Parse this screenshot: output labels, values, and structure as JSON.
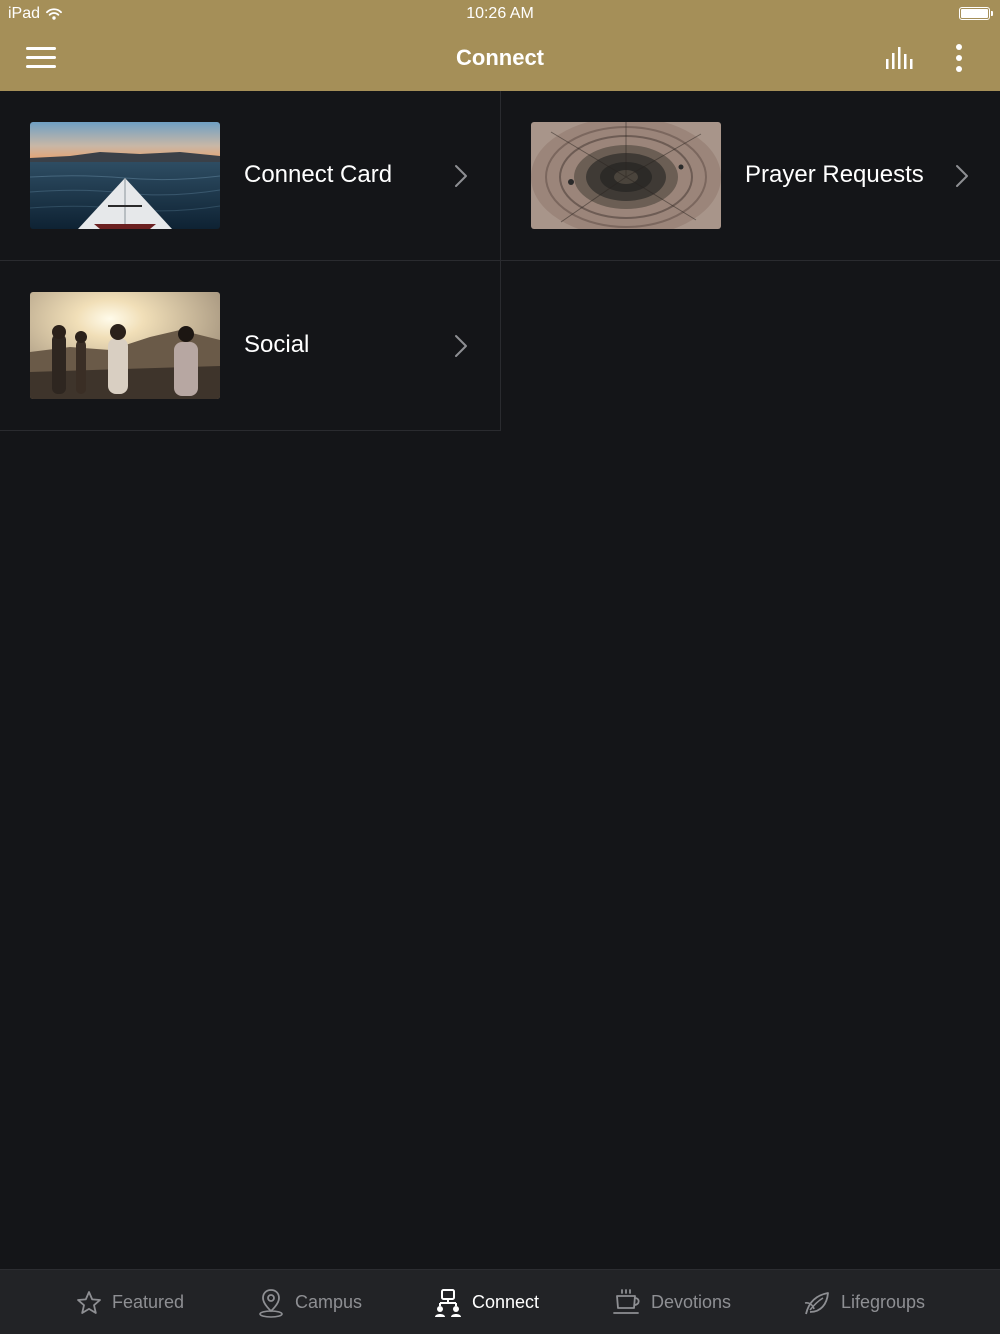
{
  "status": {
    "carrier": "iPad",
    "time": "10:26 AM"
  },
  "header": {
    "title": "Connect"
  },
  "items": [
    {
      "label": "Connect Card",
      "image": "kayak-lake-photo"
    },
    {
      "label": "Prayer Requests",
      "image": "tree-rings-photo"
    },
    {
      "label": "Social",
      "image": "friends-sunset-photo"
    }
  ],
  "tabs": [
    {
      "label": "Featured",
      "icon": "star-icon",
      "active": false
    },
    {
      "label": "Campus",
      "icon": "map-pin-icon",
      "active": false
    },
    {
      "label": "Connect",
      "icon": "connect-people-icon",
      "active": true
    },
    {
      "label": "Devotions",
      "icon": "coffee-cup-icon",
      "active": false
    },
    {
      "label": "Lifegroups",
      "icon": "leaf-icon",
      "active": false
    }
  ],
  "colors": {
    "header": "#a58f58",
    "background": "#141518",
    "tabbar": "#222326",
    "tab_inactive": "#8e8f93",
    "tab_active": "#ffffff"
  }
}
